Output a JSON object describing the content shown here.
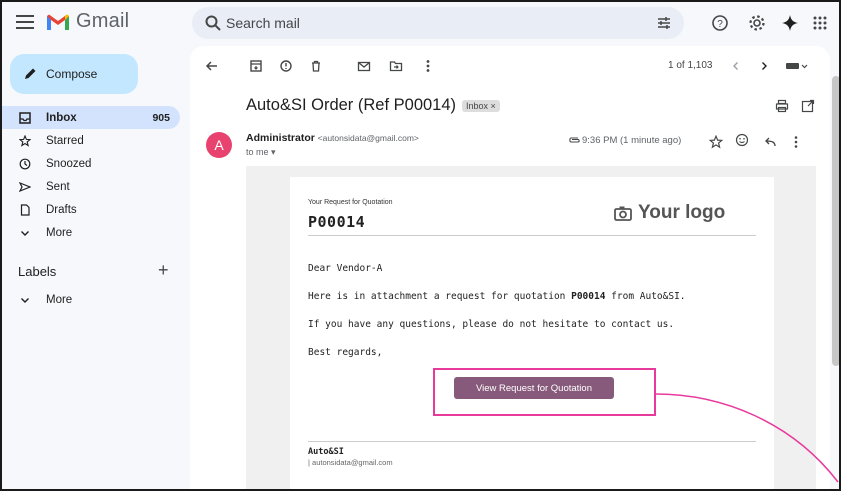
{
  "app": {
    "name": "Gmail"
  },
  "search": {
    "placeholder": "Search mail"
  },
  "compose": {
    "label": "Compose"
  },
  "nav": {
    "items": [
      {
        "label": "Inbox",
        "count": "905",
        "icon": "inbox-icon"
      },
      {
        "label": "Starred",
        "icon": "star-icon"
      },
      {
        "label": "Snoozed",
        "icon": "clock-icon"
      },
      {
        "label": "Sent",
        "icon": "send-icon"
      },
      {
        "label": "Drafts",
        "icon": "draft-icon"
      },
      {
        "label": "More",
        "icon": "chevron-down-icon"
      }
    ]
  },
  "labels": {
    "header": "Labels",
    "more": "More"
  },
  "toolbar": {
    "pagination": "1 of 1,103"
  },
  "email": {
    "subject": "Auto&SI Order (Ref P00014)",
    "chip": "Inbox ×",
    "sender_name": "Administrator",
    "sender_email": "<autonsidata@gmail.com>",
    "to": "to me ▾",
    "time": "9:36 PM (1 minute ago)",
    "avatar_letter": "A",
    "avatar_color": "#e8436e"
  },
  "body": {
    "rfq_label": "Your Request for Quotation",
    "rfq_number": "P00014",
    "logo_text": "Your logo",
    "greeting": "Dear Vendor-A",
    "line1_pre": "Here is in attachment a request for quotation ",
    "line1_bold": "P00014",
    "line1_post": " from Auto&SI.",
    "line2": "If you have any questions, please do not hesitate to contact us.",
    "line3": "Best regards,",
    "cta_label": "View Request for Quotation",
    "cta_color": "#875a7b",
    "sig_name": "Auto&SI",
    "sig_email": "| autonsidata@gmail.com"
  },
  "annotation": {
    "highlight_color": "#e8399c"
  }
}
